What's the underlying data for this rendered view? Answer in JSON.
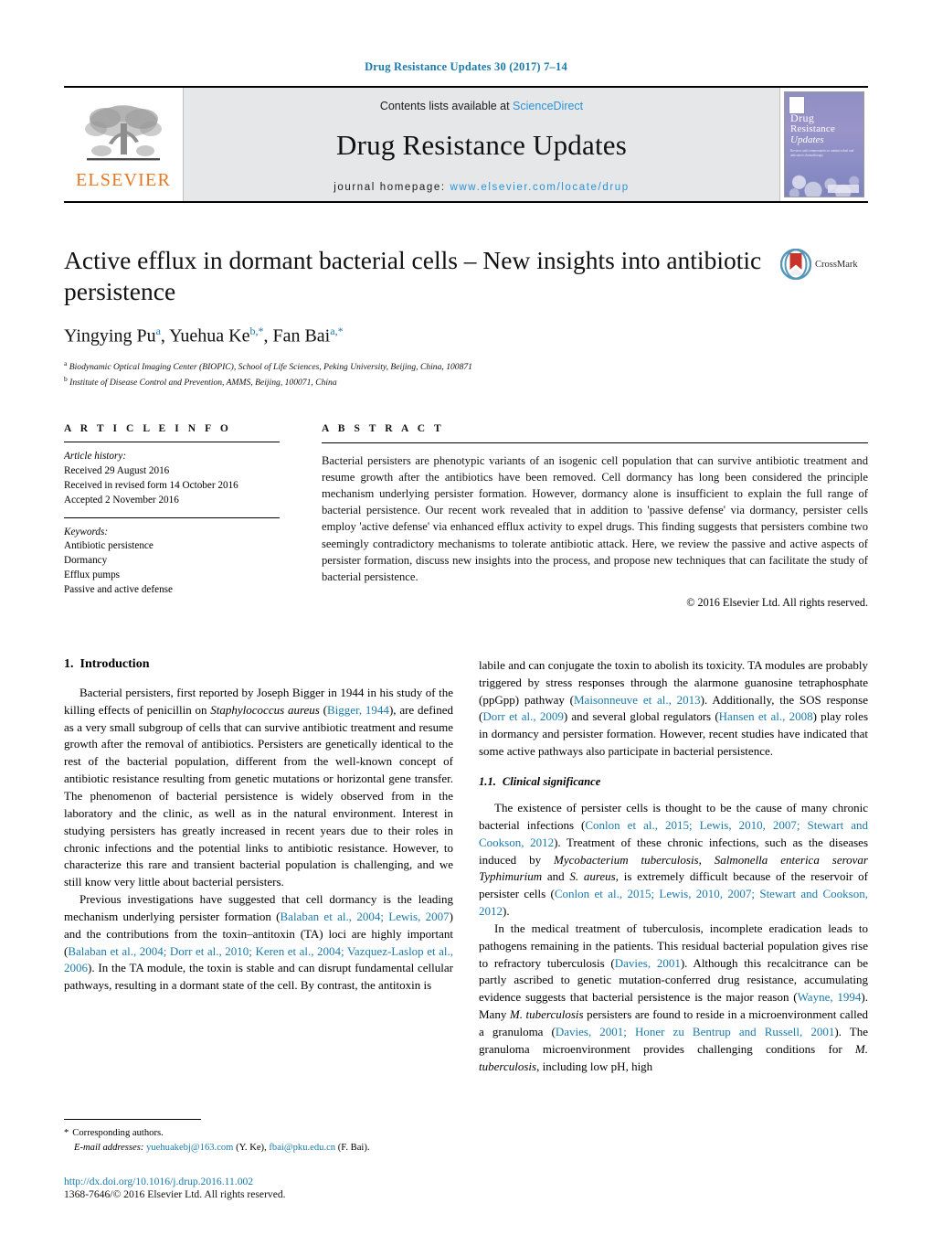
{
  "running_head": "Drug Resistance Updates 30 (2017) 7–14",
  "banner": {
    "publisher_logo_text": "ELSEVIER",
    "contents_prefix": "Contents lists available at ",
    "contents_link": "ScienceDirect",
    "journal_title": "Drug Resistance Updates",
    "homepage_prefix": "journal homepage: ",
    "homepage_url": "www.elsevier.com/locate/drup",
    "cover": {
      "line1": "Drug",
      "line2": "Resistance",
      "line3": "Updates",
      "subtitle": "Reviews and commentaries in antimicrobial and anticancer chemotherapy"
    }
  },
  "article": {
    "title": "Active efflux in dormant bacterial cells – New insights into antibiotic persistence",
    "authors_html": "Yingying Pu<sup>a</sup>, Yuehua Ke<sup>b,*</sup>, Fan Bai<sup>a,*</sup>",
    "affiliations": [
      "Biodynamic Optical Imaging Center (BIOPIC), School of Life Sciences, Peking University, Beijing, China, 100871",
      "Institute of Disease Control and Prevention, AMMS, Beijing, 100071, China"
    ],
    "crossmark_label": "CrossMark"
  },
  "article_info": {
    "heading": "A R T I C L E   I N F O",
    "history_label": "Article history:",
    "history": [
      "Received 29 August 2016",
      "Received in revised form 14 October 2016",
      "Accepted 2 November 2016"
    ],
    "keywords_label": "Keywords:",
    "keywords": [
      "Antibiotic persistence",
      "Dormancy",
      "Efflux pumps",
      "Passive and active defense"
    ]
  },
  "abstract": {
    "heading": "A B S T R A C T",
    "text": "Bacterial persisters are phenotypic variants of an isogenic cell population that can survive antibiotic treatment and resume growth after the antibiotics have been removed. Cell dormancy has long been considered the principle mechanism underlying persister formation. However, dormancy alone is insufficient to explain the full range of bacterial persistence. Our recent work revealed that in addition to 'passive defense' via dormancy, persister cells employ 'active defense' via enhanced efflux activity to expel drugs. This finding suggests that persisters combine two seemingly contradictory mechanisms to tolerate antibiotic attack. Here, we review the passive and active aspects of persister formation, discuss new insights into the process, and propose new techniques that can facilitate the study of bacterial persistence.",
    "copyright": "© 2016 Elsevier Ltd. All rights reserved."
  },
  "sections": {
    "intro_num": "1.",
    "intro_title": "Introduction",
    "clinical_num": "1.1.",
    "clinical_title": "Clinical significance"
  },
  "footnote": {
    "corresponding": "Corresponding authors.",
    "email_label": "E-mail addresses:",
    "email1": "yuehuakebj@163.com",
    "email1_who": "(Y. Ke),",
    "email2": "fbai@pku.edu.cn",
    "email2_who": "(F. Bai)."
  },
  "footer": {
    "doi": "http://dx.doi.org/10.1016/j.drup.2016.11.002",
    "issn_line": "1368-7646/© 2016 Elsevier Ltd. All rights reserved."
  },
  "colors": {
    "link": "#1a7aab",
    "sciencedirect": "#2a93d4",
    "elsevier_orange": "#E87722",
    "banner_bg": "#e6e7e9"
  }
}
